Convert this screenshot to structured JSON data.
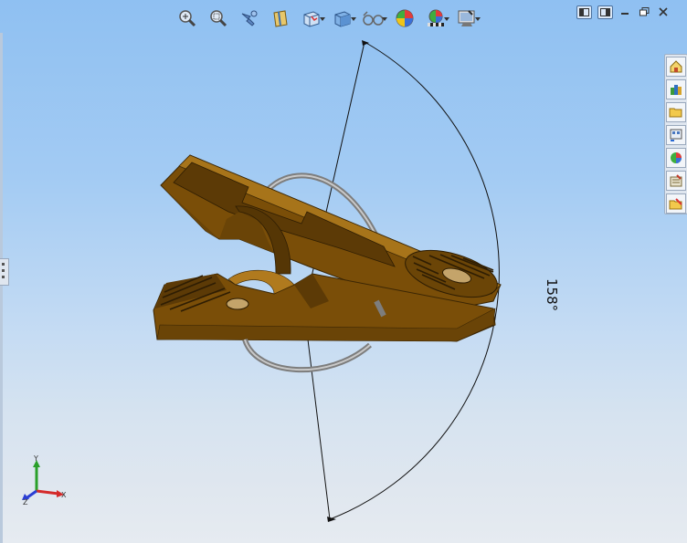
{
  "toolbar": {
    "items": [
      {
        "name": "zoom-to-fit-icon",
        "caret": false
      },
      {
        "name": "zoom-to-area-icon",
        "caret": false
      },
      {
        "name": "previous-view-icon",
        "caret": false
      },
      {
        "name": "section-view-icon",
        "caret": false
      },
      {
        "name": "view-orientation-icon",
        "caret": true
      },
      {
        "name": "display-style-icon",
        "caret": true
      },
      {
        "name": "hide-show-items-icon",
        "caret": true
      },
      {
        "name": "edit-appearance-icon",
        "caret": false
      },
      {
        "name": "apply-scene-icon",
        "caret": true
      },
      {
        "name": "view-settings-icon",
        "caret": true
      }
    ]
  },
  "window_controls": [
    "tile-left-icon",
    "tile-right-icon",
    "minimize-icon",
    "restore-icon",
    "close-icon"
  ],
  "task_pane": [
    "home-icon",
    "design-library-icon",
    "file-explorer-icon",
    "view-palette-icon",
    "appearances-icon",
    "custom-properties-icon",
    "open-file-icon"
  ],
  "dimension": {
    "angle_text": "158°"
  },
  "triad": {
    "x": "X",
    "y": "Y",
    "z": "Z"
  },
  "colors": {
    "part": "#8a5a0a",
    "part_light": "#a87414",
    "part_dark": "#5e3c05",
    "ring": "#8c8c8c"
  }
}
